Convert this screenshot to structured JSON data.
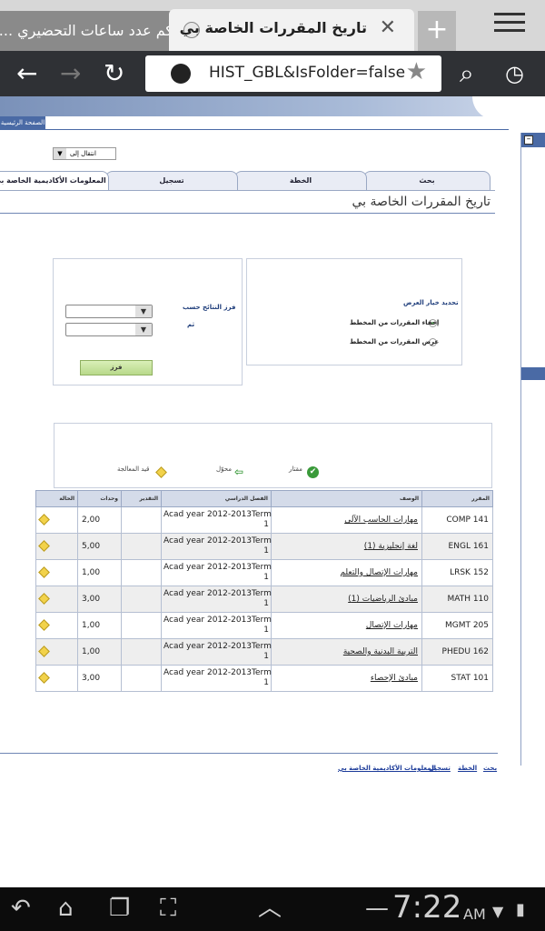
{
  "browser": {
    "tab_inactive_title": "كم عدد ساعات التحضيري ...",
    "tab_active_title": "تاريخ المقررات الخاصة بي",
    "url": "HIST_GBL&IsFolder=false"
  },
  "page": {
    "home_tab": "الصفحة الرئيسية",
    "jump_to": "انتقال إلى",
    "nav_tabs": [
      "بحث",
      "الخطة",
      "تسجيل",
      "المعلومات الأكاديمية الخاصة بي"
    ],
    "title": "تاريخ المقررات الخاصة بي",
    "display_options": {
      "title": "تحديد خيار العرض",
      "opt_hide": "إخفاء المقررات من المخطط",
      "opt_show": "عرض المقررات من المخطط"
    },
    "sort": {
      "label": "فرز النتائج حسب",
      "then": "ثم",
      "button": "فرز"
    },
    "legend": {
      "taken": "مقتار",
      "transferred": "محوّل",
      "in_progress": "قيد المعالجة"
    },
    "table": {
      "headers": [
        "المقرر",
        "الوصف",
        "الفصل الدراسي",
        "التقدير",
        "وحدات",
        "الحالة"
      ],
      "rows": [
        {
          "course": "COMP 141",
          "desc": "مهارات الحاسب الآلي",
          "term1": "Acad year 2012-2013Term",
          "term2": "1",
          "grade": "",
          "units": "2,00"
        },
        {
          "course": "ENGL 161",
          "desc": "لغة إنجليزية (1)",
          "term1": "Acad year 2012-2013Term",
          "term2": "1",
          "grade": "",
          "units": "5,00"
        },
        {
          "course": "LRSK 152",
          "desc": "مهارات الإتصال والتعلم",
          "term1": "Acad year 2012-2013Term",
          "term2": "1",
          "grade": "",
          "units": "1,00"
        },
        {
          "course": "MATH 110",
          "desc": "مبادئ الرياضيات (1)",
          "term1": "Acad year 2012-2013Term",
          "term2": "1",
          "grade": "",
          "units": "3,00"
        },
        {
          "course": "MGMT 205",
          "desc": "مهارات الإتصال",
          "term1": "Acad year 2012-2013Term",
          "term2": "1",
          "grade": "",
          "units": "1,00"
        },
        {
          "course": "PHEDU 162",
          "desc": "التربية البدنية والصحية",
          "term1": "Acad year 2012-2013Term",
          "term2": "1",
          "grade": "",
          "units": "1,00"
        },
        {
          "course": "STAT 101",
          "desc": "مبادئ الإحصاء",
          "term1": "Acad year 2012-2013Term",
          "term2": "1",
          "grade": "",
          "units": "3,00"
        }
      ]
    },
    "footer_links": [
      "بحث",
      "الخطة",
      "تسجيل",
      "المعلومات الأكاديمية الخاصة بي"
    ]
  },
  "system": {
    "clock": "7:22",
    "ampm": "AM"
  }
}
